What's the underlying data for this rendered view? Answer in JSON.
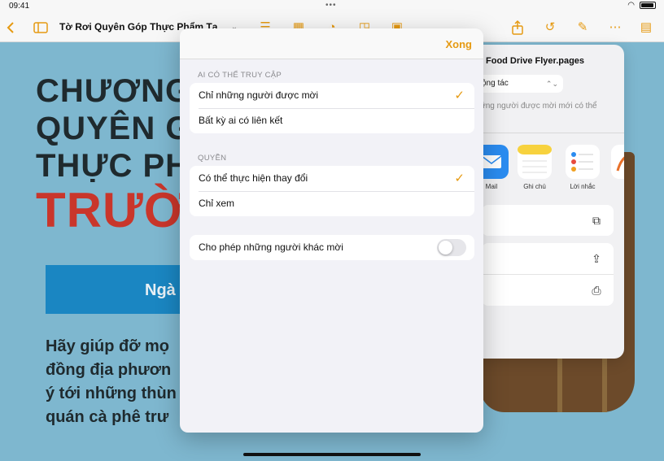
{
  "status": {
    "time": "09:41",
    "dots": "•••"
  },
  "toolbar": {
    "doc_title": "Tờ Rơi Quyên Góp Thực Phẩm Tại T"
  },
  "document": {
    "headline_lines": [
      "CHƯƠNG",
      "QUYÊN G",
      "THỰC PH"
    ],
    "headline_red": "TRƯỜ",
    "date_text": "Ngà",
    "body_lines": [
      "Hãy giúp đỡ mọ",
      "đồng địa phươn",
      "ý tới những thùn",
      "quán cà phê trư"
    ]
  },
  "share": {
    "file_name": "Food Drive Flyer.pages",
    "collab_value": "ộng tác",
    "description": "ững người được mời mới có thể",
    "apps": [
      {
        "label": "Mail",
        "icon": "mail-icon",
        "color": "#2b8cf0"
      },
      {
        "label": "Ghi chú",
        "icon": "notes-icon",
        "color": "#f7d23e"
      },
      {
        "label": "Lời nhắc",
        "icon": "reminders-icon",
        "color": "#ffffff"
      },
      {
        "label": "Fr",
        "icon": "freeform-icon",
        "color": "#ffffff"
      }
    ]
  },
  "modal": {
    "done_label": "Xong",
    "access_section": "AI CÓ THỂ TRUY CẬP",
    "access_options": [
      {
        "label": "Chỉ những người được mời",
        "selected": true
      },
      {
        "label": "Bất kỳ ai có liên kết",
        "selected": false
      }
    ],
    "permission_section": "QUYỀN",
    "permission_options": [
      {
        "label": "Có thể thực hiện thay đổi",
        "selected": true
      },
      {
        "label": "Chỉ xem",
        "selected": false
      }
    ],
    "allow_invite_label": "Cho phép những người khác mời",
    "allow_invite_on": false
  },
  "colors": {
    "accent": "#e69a12",
    "canvas": "#7eb7cf",
    "headline_red": "#c9362b"
  }
}
